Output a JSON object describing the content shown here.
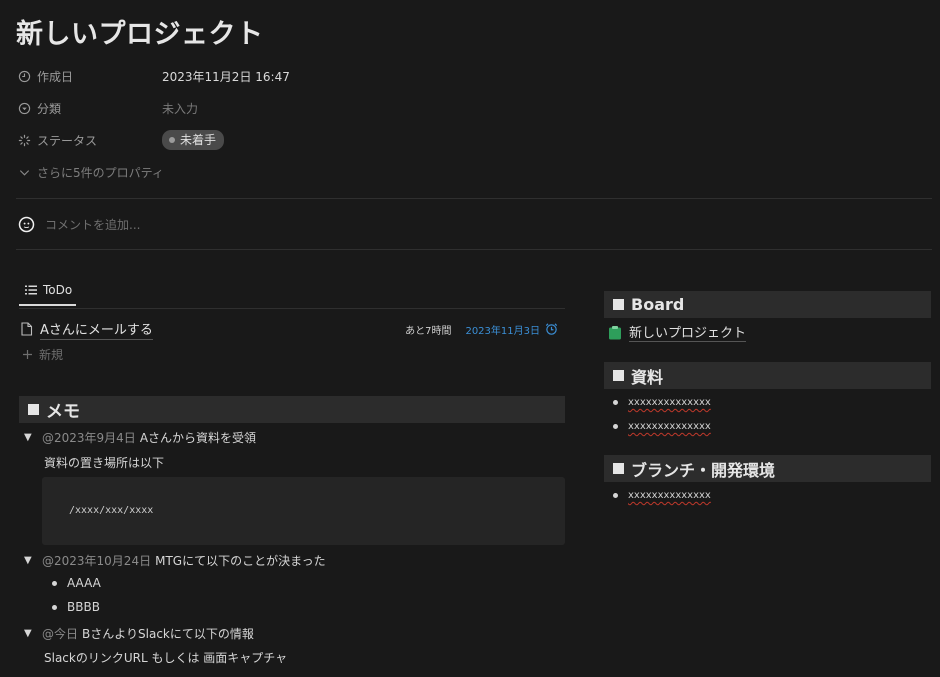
{
  "page": {
    "title": "新しいプロジェクト"
  },
  "properties": {
    "created": {
      "label": "作成日",
      "value": "2023年11月2日 16:47"
    },
    "category": {
      "label": "分類",
      "value": "未入力"
    },
    "status": {
      "label": "ステータス",
      "value": "未着手"
    },
    "more": "さらに5件のプロパティ"
  },
  "comment": {
    "placeholder": "コメントを追加..."
  },
  "todo": {
    "tab_label": "ToDo",
    "item_title": "Aさんにメールする",
    "remaining": "あと7時間",
    "date": "2023年11月3日",
    "new_label": "新規"
  },
  "memo": {
    "title": "メモ",
    "entries": [
      {
        "mention": "@2023年9月4日",
        "text": "Aさんから資料を受領",
        "body": "資料の置き場所は以下",
        "code": "/xxxx/xxx/xxxx"
      },
      {
        "mention": "@2023年10月24日",
        "text": "MTGにて以下のことが決まった",
        "bullets": [
          "AAAA",
          "BBBB"
        ]
      },
      {
        "mention": "@今日",
        "text": "BさんよりSlackにて以下の情報",
        "body": "SlackのリンクURL もしくは 画面キャプチャ"
      }
    ]
  },
  "sidebar": {
    "board": {
      "title": "Board",
      "link": "新しいプロジェクト"
    },
    "materials": {
      "title": "資料",
      "items": [
        "xxxxxxxxxxxxxx",
        "xxxxxxxxxxxxxx"
      ]
    },
    "branch": {
      "title": "ブランチ・開発環境",
      "items": [
        "xxxxxxxxxxxxxx"
      ]
    }
  },
  "colors": {
    "background": "#191919",
    "link_blue": "#3b8fd6",
    "board_icon": "#2e9e5b",
    "spell_underline": "#c0392b"
  }
}
